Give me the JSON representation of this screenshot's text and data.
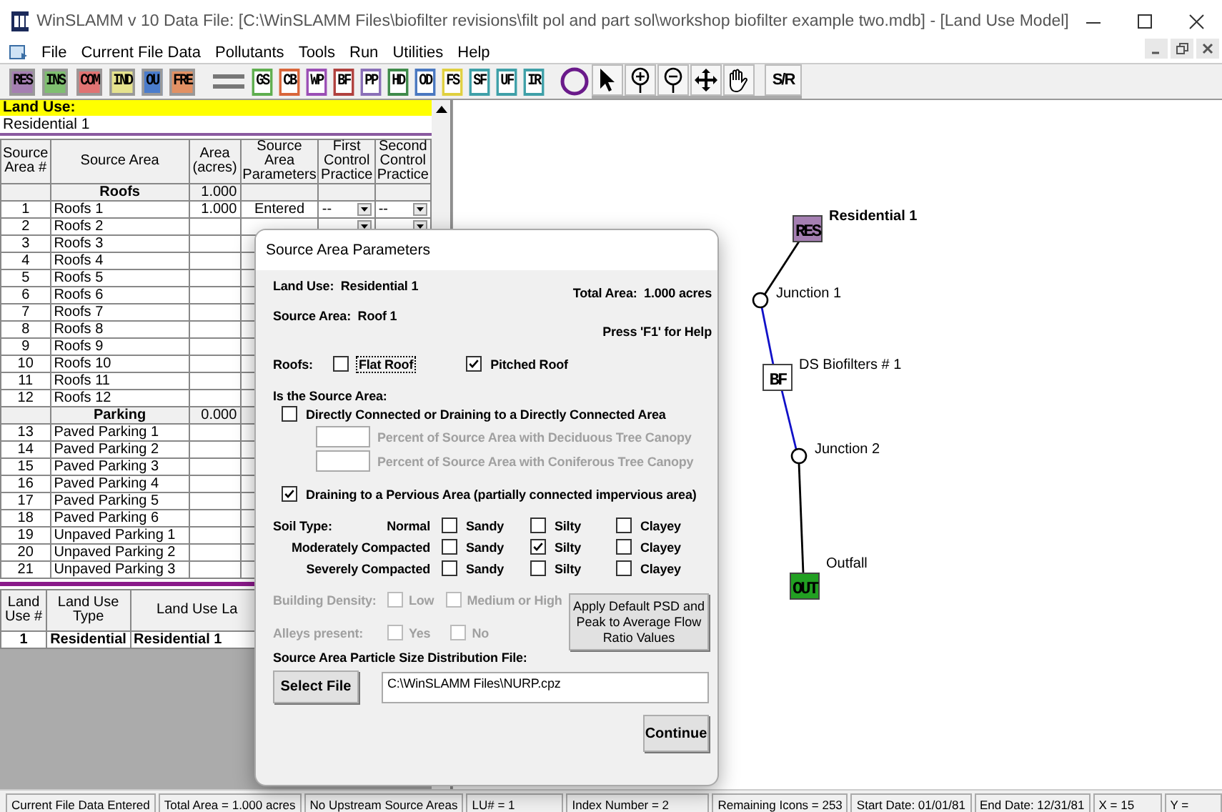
{
  "window": {
    "title": "WinSLAMM v 10 Data File:  [C:\\WinSLAMM Files\\biofilter revisions\\filt pol and part sol\\workshop biofilter example two.mdb] - [Land Use Model]"
  },
  "menu": [
    "File",
    "Current File Data",
    "Pollutants",
    "Tools",
    "Run",
    "Utilities",
    "Help"
  ],
  "toolbar": [
    {
      "kind": "filled",
      "label": "RES",
      "color": "#a57fb2"
    },
    {
      "kind": "filled",
      "label": "INS",
      "color": "#7fbf70"
    },
    {
      "kind": "filled",
      "label": "COM",
      "color": "#e07373"
    },
    {
      "kind": "filled",
      "label": "IND",
      "color": "#e6e38e"
    },
    {
      "kind": "filled",
      "label": "OU",
      "color": "#4a7ccc"
    },
    {
      "kind": "filled",
      "label": "FRE",
      "color": "#e29164"
    },
    {
      "kind": "line"
    },
    {
      "kind": "outlined",
      "label": "GS",
      "color": "#5fae4f"
    },
    {
      "kind": "outlined",
      "label": "CB",
      "color": "#d9663a"
    },
    {
      "kind": "outlined",
      "label": "WP",
      "color": "#9b4fb5"
    },
    {
      "kind": "outlined",
      "label": "BF",
      "color": "#b0413e"
    },
    {
      "kind": "outlined",
      "label": "PP",
      "color": "#8a6fb8"
    },
    {
      "kind": "outlined",
      "label": "HD",
      "color": "#3f8a4a"
    },
    {
      "kind": "outlined",
      "label": "OD",
      "color": "#4a78c0"
    },
    {
      "kind": "outlined",
      "label": "FS",
      "color": "#e0d040"
    },
    {
      "kind": "outlined",
      "label": "SF",
      "color": "#3fa0a8"
    },
    {
      "kind": "outlined",
      "label": "UF",
      "color": "#3fa0a8"
    },
    {
      "kind": "outlined",
      "label": "IR",
      "color": "#3fa0a8"
    },
    {
      "kind": "circle",
      "color": "#6a1a8a"
    }
  ],
  "tools": [
    {
      "kind": "pointer"
    },
    {
      "kind": "zoom_in"
    },
    {
      "kind": "zoom_out"
    },
    {
      "kind": "move"
    },
    {
      "kind": "hand"
    },
    {
      "kind": "text",
      "label": "S/R"
    }
  ],
  "land_use": {
    "label": "Land Use:",
    "value": "Residential 1"
  },
  "grid": {
    "columns": [
      "Source Area #",
      "Source Area",
      "Area (acres)",
      "Source Area Parameters",
      "First Control Practice",
      "Second Control Practice"
    ],
    "rows": [
      {
        "kind": "group",
        "name": "Roofs",
        "area": "1.000"
      },
      {
        "kind": "item",
        "number": "1",
        "name": "Roofs 1",
        "area": "1.000",
        "parameters": "Entered",
        "first": "--",
        "second": "--",
        "dropdowns": true
      },
      {
        "kind": "item",
        "number": "2",
        "name": "Roofs 2",
        "dropdowns": true
      },
      {
        "kind": "item",
        "number": "3",
        "name": "Roofs 3"
      },
      {
        "kind": "item",
        "number": "4",
        "name": "Roofs 4"
      },
      {
        "kind": "item",
        "number": "5",
        "name": "Roofs 5"
      },
      {
        "kind": "item",
        "number": "6",
        "name": "Roofs 6"
      },
      {
        "kind": "item",
        "number": "7",
        "name": "Roofs 7"
      },
      {
        "kind": "item",
        "number": "8",
        "name": "Roofs 8"
      },
      {
        "kind": "item",
        "number": "9",
        "name": "Roofs 9"
      },
      {
        "kind": "item",
        "number": "10",
        "name": "Roofs 10"
      },
      {
        "kind": "item",
        "number": "11",
        "name": "Roofs 11"
      },
      {
        "kind": "item",
        "number": "12",
        "name": "Roofs 12"
      },
      {
        "kind": "group",
        "name": "Parking",
        "area": "0.000"
      },
      {
        "kind": "item",
        "number": "13",
        "name": "Paved Parking 1"
      },
      {
        "kind": "item",
        "number": "14",
        "name": "Paved Parking 2"
      },
      {
        "kind": "item",
        "number": "15",
        "name": "Paved Parking 3"
      },
      {
        "kind": "item",
        "number": "16",
        "name": "Paved Parking 4"
      },
      {
        "kind": "item",
        "number": "17",
        "name": "Paved Parking 5"
      },
      {
        "kind": "item",
        "number": "18",
        "name": "Paved Parking 6"
      },
      {
        "kind": "item",
        "number": "19",
        "name": "Unpaved Parking 1"
      },
      {
        "kind": "item",
        "number": "20",
        "name": "Unpaved Parking 2"
      },
      {
        "kind": "item",
        "number": "21",
        "name": "Unpaved Parking 3"
      }
    ]
  },
  "land_use_table": {
    "columns": [
      "Land Use #",
      "Land Use Type",
      "Land Use La"
    ],
    "rows": [
      [
        "1",
        "Residential",
        "Residential 1"
      ]
    ]
  },
  "diagram": {
    "nodes": [
      {
        "kind": "icon",
        "code": "RES",
        "label": "Residential 1",
        "color": "#a57fb2"
      },
      {
        "kind": "junction",
        "label": "Junction 1"
      },
      {
        "kind": "icon",
        "code": "BF",
        "label": "DS Biofilters # 1",
        "color": "#ffffff"
      },
      {
        "kind": "junction",
        "label": "Junction 2"
      },
      {
        "kind": "icon",
        "code": "OUT",
        "label": "Outfall",
        "color": "#22a022"
      }
    ],
    "links": [
      {
        "color": "#000000"
      },
      {
        "color": "#1010c8"
      },
      {
        "color": "#1010c8"
      },
      {
        "color": "#000000"
      }
    ]
  },
  "dialog": {
    "title": "Source Area Parameters",
    "land_use": "Land Use:  Residential 1",
    "total_area": "Total Area:  1.000 acres",
    "source_area": "Source Area:  Roof 1",
    "help": "Press 'F1' for Help",
    "roofs": {
      "label": "Roofs:",
      "options": [
        {
          "label": "Flat Roof",
          "checked": false,
          "focused": true
        },
        {
          "label": "Pitched Roof",
          "checked": true,
          "focused": false
        }
      ]
    },
    "connection_heading": "Is the Source Area:",
    "directly_connected": {
      "label": "Directly Connected or Draining to a Directly Connected Area",
      "checked": false
    },
    "canopy_fields": [
      {
        "label": "Percent of Source Area with Deciduous Tree Canopy",
        "disabled": true
      },
      {
        "label": "Percent of Source Area with Coniferous Tree Canopy",
        "disabled": true
      }
    ],
    "pervious": {
      "label": "Draining to a Pervious Area (partially connected impervious area)",
      "checked": true
    },
    "soil": {
      "label": "Soil Type:",
      "rows": [
        {
          "label": "Normal",
          "options": [
            {
              "label": "Sandy",
              "checked": false
            },
            {
              "label": "Silty",
              "checked": false
            },
            {
              "label": "Clayey",
              "checked": false
            }
          ]
        },
        {
          "label": "Moderately Compacted",
          "options": [
            {
              "label": "Sandy",
              "checked": false
            },
            {
              "label": "Silty",
              "checked": true
            },
            {
              "label": "Clayey",
              "checked": false
            }
          ]
        },
        {
          "label": "Severely Compacted",
          "options": [
            {
              "label": "Sandy",
              "checked": false
            },
            {
              "label": "Silty",
              "checked": false
            },
            {
              "label": "Clayey",
              "checked": false
            }
          ]
        }
      ]
    },
    "density": {
      "label": "Building Density:",
      "disabled": true,
      "options": [
        {
          "label": "Low",
          "checked": false
        },
        {
          "label": "Medium or High",
          "checked": false
        }
      ]
    },
    "alleys": {
      "label": "Alleys present:",
      "disabled": true,
      "options": [
        {
          "label": "Yes",
          "checked": false
        },
        {
          "label": "No",
          "checked": false
        }
      ]
    },
    "apply_button": "Apply Default PSD and Peak to Average Flow Ratio Values",
    "psd_label": "Source Area Particle Size Distribution File:",
    "select_button": "Select File",
    "psd_file": "C:\\WinSLAMM Files\\NURP.cpz",
    "continue_button": "Continue"
  },
  "status_bar": [
    "Current File Data Entered",
    "Total Area = 1.000 acres",
    "No Upstream Source Areas",
    "LU# = 1",
    "Index Number = 2",
    "Remaining Icons =  253",
    "Start Date:  01/01/81",
    "End Date:  12/31/81",
    "X =  15",
    "Y ="
  ]
}
